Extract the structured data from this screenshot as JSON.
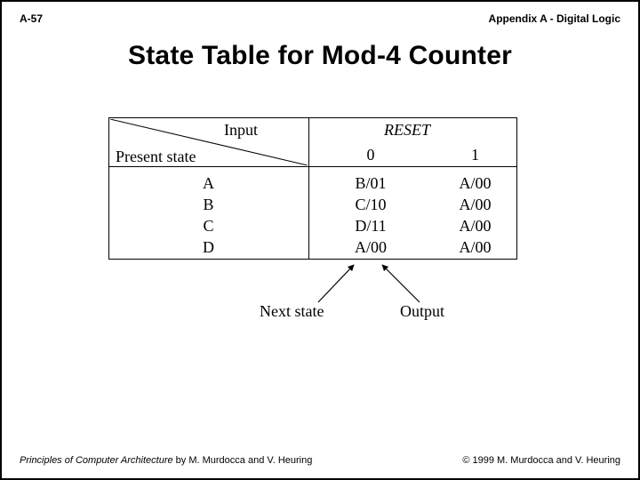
{
  "header": {
    "page_label": "A-57",
    "appendix_label": "Appendix A - Digital Logic"
  },
  "title": "State Table for Mod-4 Counter",
  "table": {
    "input_header": "Input",
    "reset_header": "RESET",
    "present_state_header": "Present state",
    "col0_header": "0",
    "col1_header": "1",
    "rows": [
      {
        "state": "A",
        "c0": "B/01",
        "c1": "A/00"
      },
      {
        "state": "B",
        "c0": "C/10",
        "c1": "A/00"
      },
      {
        "state": "C",
        "c0": "D/11",
        "c1": "A/00"
      },
      {
        "state": "D",
        "c0": "A/00",
        "c1": "A/00"
      }
    ],
    "next_state_label": "Next state",
    "output_label": "Output"
  },
  "footer": {
    "book_title": "Principles of Computer Architecture",
    "by_line": " by M. Murdocca and V. Heuring",
    "copyright": "© 1999 M. Murdocca and V. Heuring"
  }
}
